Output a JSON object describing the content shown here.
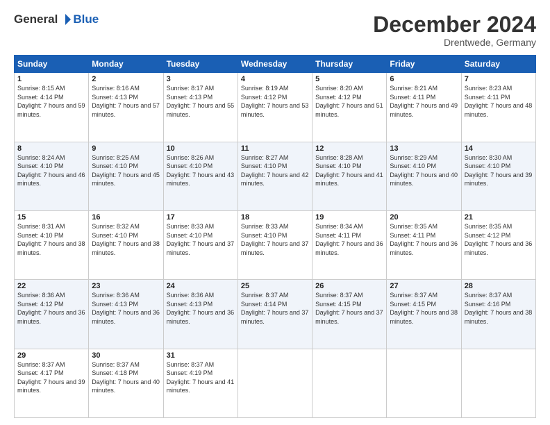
{
  "logo": {
    "general": "General",
    "blue": "Blue"
  },
  "header": {
    "title": "December 2024",
    "location": "Drentwede, Germany"
  },
  "weekdays": [
    "Sunday",
    "Monday",
    "Tuesday",
    "Wednesday",
    "Thursday",
    "Friday",
    "Saturday"
  ],
  "weeks": [
    [
      {
        "day": "1",
        "sunrise": "8:15 AM",
        "sunset": "4:14 PM",
        "daylight": "7 hours and 59 minutes."
      },
      {
        "day": "2",
        "sunrise": "8:16 AM",
        "sunset": "4:13 PM",
        "daylight": "7 hours and 57 minutes."
      },
      {
        "day": "3",
        "sunrise": "8:17 AM",
        "sunset": "4:13 PM",
        "daylight": "7 hours and 55 minutes."
      },
      {
        "day": "4",
        "sunrise": "8:19 AM",
        "sunset": "4:12 PM",
        "daylight": "7 hours and 53 minutes."
      },
      {
        "day": "5",
        "sunrise": "8:20 AM",
        "sunset": "4:12 PM",
        "daylight": "7 hours and 51 minutes."
      },
      {
        "day": "6",
        "sunrise": "8:21 AM",
        "sunset": "4:11 PM",
        "daylight": "7 hours and 49 minutes."
      },
      {
        "day": "7",
        "sunrise": "8:23 AM",
        "sunset": "4:11 PM",
        "daylight": "7 hours and 48 minutes."
      }
    ],
    [
      {
        "day": "8",
        "sunrise": "8:24 AM",
        "sunset": "4:10 PM",
        "daylight": "7 hours and 46 minutes."
      },
      {
        "day": "9",
        "sunrise": "8:25 AM",
        "sunset": "4:10 PM",
        "daylight": "7 hours and 45 minutes."
      },
      {
        "day": "10",
        "sunrise": "8:26 AM",
        "sunset": "4:10 PM",
        "daylight": "7 hours and 43 minutes."
      },
      {
        "day": "11",
        "sunrise": "8:27 AM",
        "sunset": "4:10 PM",
        "daylight": "7 hours and 42 minutes."
      },
      {
        "day": "12",
        "sunrise": "8:28 AM",
        "sunset": "4:10 PM",
        "daylight": "7 hours and 41 minutes."
      },
      {
        "day": "13",
        "sunrise": "8:29 AM",
        "sunset": "4:10 PM",
        "daylight": "7 hours and 40 minutes."
      },
      {
        "day": "14",
        "sunrise": "8:30 AM",
        "sunset": "4:10 PM",
        "daylight": "7 hours and 39 minutes."
      }
    ],
    [
      {
        "day": "15",
        "sunrise": "8:31 AM",
        "sunset": "4:10 PM",
        "daylight": "7 hours and 38 minutes."
      },
      {
        "day": "16",
        "sunrise": "8:32 AM",
        "sunset": "4:10 PM",
        "daylight": "7 hours and 38 minutes."
      },
      {
        "day": "17",
        "sunrise": "8:33 AM",
        "sunset": "4:10 PM",
        "daylight": "7 hours and 37 minutes."
      },
      {
        "day": "18",
        "sunrise": "8:33 AM",
        "sunset": "4:10 PM",
        "daylight": "7 hours and 37 minutes."
      },
      {
        "day": "19",
        "sunrise": "8:34 AM",
        "sunset": "4:11 PM",
        "daylight": "7 hours and 36 minutes."
      },
      {
        "day": "20",
        "sunrise": "8:35 AM",
        "sunset": "4:11 PM",
        "daylight": "7 hours and 36 minutes."
      },
      {
        "day": "21",
        "sunrise": "8:35 AM",
        "sunset": "4:12 PM",
        "daylight": "7 hours and 36 minutes."
      }
    ],
    [
      {
        "day": "22",
        "sunrise": "8:36 AM",
        "sunset": "4:12 PM",
        "daylight": "7 hours and 36 minutes."
      },
      {
        "day": "23",
        "sunrise": "8:36 AM",
        "sunset": "4:13 PM",
        "daylight": "7 hours and 36 minutes."
      },
      {
        "day": "24",
        "sunrise": "8:36 AM",
        "sunset": "4:13 PM",
        "daylight": "7 hours and 36 minutes."
      },
      {
        "day": "25",
        "sunrise": "8:37 AM",
        "sunset": "4:14 PM",
        "daylight": "7 hours and 37 minutes."
      },
      {
        "day": "26",
        "sunrise": "8:37 AM",
        "sunset": "4:15 PM",
        "daylight": "7 hours and 37 minutes."
      },
      {
        "day": "27",
        "sunrise": "8:37 AM",
        "sunset": "4:15 PM",
        "daylight": "7 hours and 38 minutes."
      },
      {
        "day": "28",
        "sunrise": "8:37 AM",
        "sunset": "4:16 PM",
        "daylight": "7 hours and 38 minutes."
      }
    ],
    [
      {
        "day": "29",
        "sunrise": "8:37 AM",
        "sunset": "4:17 PM",
        "daylight": "7 hours and 39 minutes."
      },
      {
        "day": "30",
        "sunrise": "8:37 AM",
        "sunset": "4:18 PM",
        "daylight": "7 hours and 40 minutes."
      },
      {
        "day": "31",
        "sunrise": "8:37 AM",
        "sunset": "4:19 PM",
        "daylight": "7 hours and 41 minutes."
      },
      null,
      null,
      null,
      null
    ]
  ]
}
